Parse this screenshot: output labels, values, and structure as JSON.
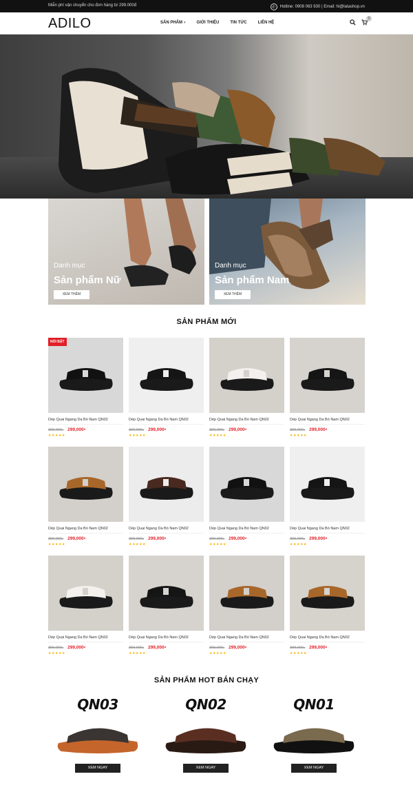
{
  "topbar": {
    "notice": "Miễn phí vận chuyển cho đơn hàng từ 299.000đ",
    "contact": "Hotline: 0908 063 930 | Email: hi@latashop.vn"
  },
  "header": {
    "logo": "ADILO",
    "nav": [
      "SẢN PHẨM",
      "GIỚI THIỆU",
      "TIN TỨC",
      "LIÊN HỆ"
    ],
    "cart_count": "0"
  },
  "categories": [
    {
      "label": "Danh mục",
      "title": "Sản phẩm Nữ",
      "button": "XEM THÊM"
    },
    {
      "label": "Danh mục",
      "title": "Sản phẩm Nam",
      "button": "XEM THÊM"
    }
  ],
  "new_products": {
    "title": "SẢN PHẨM MỚI",
    "badge": "NỔI BẬT",
    "currency": "đ",
    "items": [
      {
        "name": "Dép Quai Ngang Da Bò Nam QN02",
        "old_price": "399,000",
        "price": "299,000",
        "stars": "★★★★★",
        "color": "#111111",
        "bg": "#d8d8d8"
      },
      {
        "name": "Dép Quai Ngang Da Bò Nam QN02",
        "old_price": "399,000",
        "price": "299,000",
        "stars": "★★★★★",
        "color": "#151515",
        "bg": "#efefef"
      },
      {
        "name": "Dép Quai Ngang Da Bò Nam QN02",
        "old_price": "399,000",
        "price": "299,000",
        "stars": "★★★★★",
        "color": "#f3f1ee",
        "bg": "#d4d0ca"
      },
      {
        "name": "Dép Quai Ngang Da Bò Nam QN02",
        "old_price": "399,000",
        "price": "299,000",
        "stars": "★★★★★",
        "color": "#151515",
        "bg": "#d6d3ce"
      },
      {
        "name": "Dép Quai Ngang Da Bò Nam QN02",
        "old_price": "399,000",
        "price": "299,000",
        "stars": "★★★★★",
        "color": "#a8672a",
        "bg": "#d3cfca"
      },
      {
        "name": "Dép Quai Ngang Da Bò Nam QN02",
        "old_price": "399,000",
        "price": "299,000",
        "stars": "★★★★★",
        "color": "#4a2a20",
        "bg": "#ececec"
      },
      {
        "name": "Dép Quai Ngang Da Bò Nam QN02",
        "old_price": "399,000",
        "price": "299,000",
        "stars": "★★★★★",
        "color": "#111111",
        "bg": "#d8d8d8"
      },
      {
        "name": "Dép Quai Ngang Da Bò Nam QN02",
        "old_price": "399,000",
        "price": "299,000",
        "stars": "★★★★★",
        "color": "#151515",
        "bg": "#efefef"
      },
      {
        "name": "Dép Quai Ngang Da Bò Nam QN02",
        "old_price": "399,000",
        "price": "299,000",
        "stars": "★★★★★",
        "color": "#f3f1ee",
        "bg": "#d4d0ca"
      },
      {
        "name": "Dép Quai Ngang Da Bò Nam QN02",
        "old_price": "399,000",
        "price": "299,000",
        "stars": "★★★★★",
        "color": "#151515",
        "bg": "#d6d3ce"
      },
      {
        "name": "Dép Quai Ngang Da Bò Nam QN02",
        "old_price": "399,000",
        "price": "299,000",
        "stars": "★★★★★",
        "color": "#a8672a",
        "bg": "#d3cfca"
      },
      {
        "name": "Dép Quai Ngang Da Bò Nam QN02",
        "old_price": "399,000",
        "price": "299,000",
        "stars": "★★★★★",
        "color": "#a8672a",
        "bg": "#d6d2cc"
      }
    ]
  },
  "hot_products": {
    "title": "SẢN PHẨM HOT BÁN CHẠY",
    "items": [
      {
        "code": "QN03",
        "button": "XEM NGAY",
        "color": "#3a3532",
        "sole": "#c4652c"
      },
      {
        "code": "QN02",
        "button": "XEM NGAY",
        "color": "#5a2f22",
        "sole": "#2a1a14"
      },
      {
        "code": "QN01",
        "button": "XEM NGAY",
        "color": "#7a6a4e",
        "sole": "#111111"
      }
    ]
  }
}
